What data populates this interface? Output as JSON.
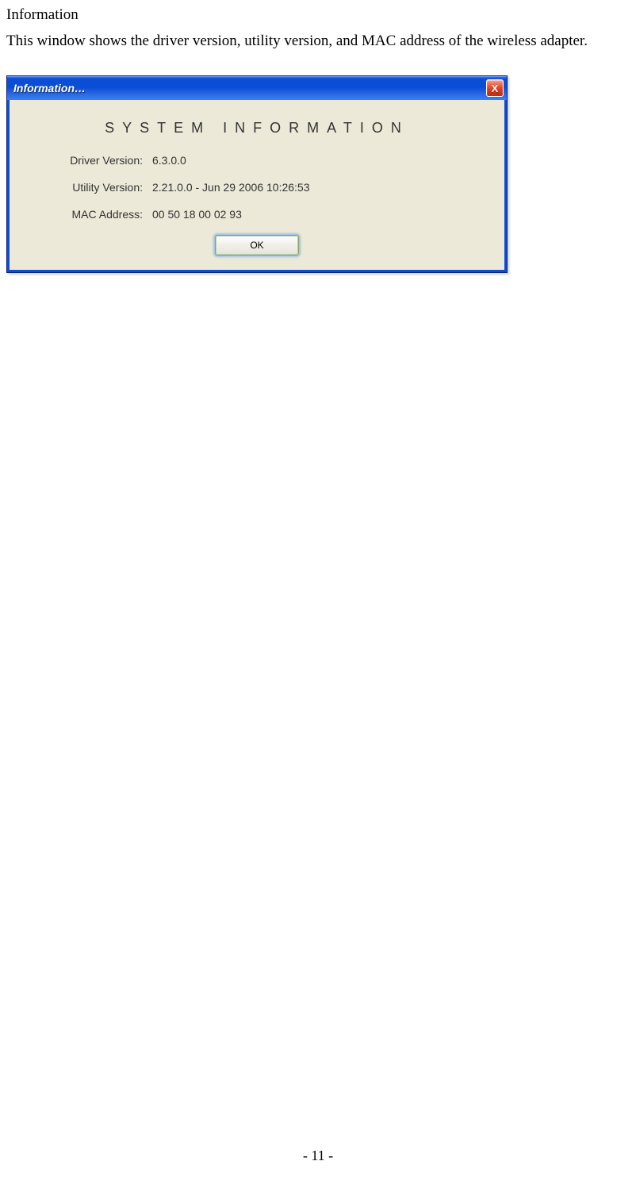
{
  "doc": {
    "heading": "Information",
    "description": "This window shows the driver version, utility version, and MAC address of the wireless adapter."
  },
  "dialog": {
    "title": "Information…",
    "heading": "SYSTEM INFORMATION",
    "rows": [
      {
        "label": "Driver Version:",
        "value": "6.3.0.0"
      },
      {
        "label": "Utility Version:",
        "value": "2.21.0.0 - Jun 29 2006 10:26:53"
      },
      {
        "label": "MAC Address:",
        "value": "00 50 18 00 02 93"
      }
    ],
    "ok_label": "OK",
    "close_label": "X"
  },
  "footer": {
    "page": "- 11 -"
  }
}
